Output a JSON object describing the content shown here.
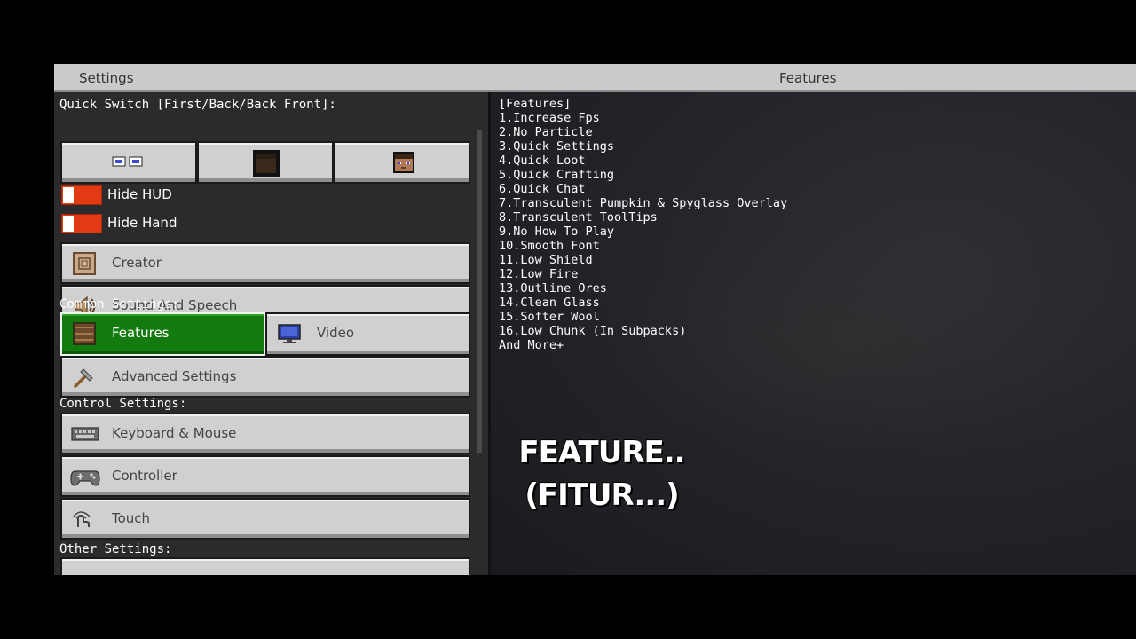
{
  "header": {
    "left_title": "Settings",
    "right_title": "Features"
  },
  "sidebar": {
    "quick_switch_label": "Quick Switch [First/Back/Back Front]:",
    "toggles": [
      {
        "label": "Hide HUD",
        "state": "off"
      },
      {
        "label": "Hide Hand",
        "state": "off"
      }
    ],
    "buttons": {
      "creator": "Creator",
      "sound": "Sound And Speech",
      "features": "Features",
      "video": "Video",
      "advanced": "Advanced Settings",
      "keyboard": "Keyboard & Mouse",
      "controller": "Controller",
      "touch": "Touch"
    },
    "common_label": "Common Settings:",
    "control_label": "Control Settings:",
    "other_label": "Other Settings:"
  },
  "content": {
    "lines": [
      "[Features]",
      "1.Increase Fps",
      "2.No Particle",
      "3.Quick Settings",
      "4.Quick Loot",
      "5.Quick Crafting",
      "6.Quick Chat",
      "7.Transculent Pumpkin & Spyglass Overlay",
      "8.Transculent ToolTips",
      "9.No How To Play",
      "10.Smooth Font",
      "11.Low Shield",
      "12.Low Fire",
      "13.Outline Ores",
      "14.Clean Glass",
      "15.Softer Wool",
      "16.Low Chunk (In Subpacks)",
      "And More+"
    ],
    "overlay_line1": "FEATURE..",
    "overlay_line2": "(FITUR...)"
  },
  "colors": {
    "accent_green": "#137a10",
    "toggle_red": "#e23b14",
    "button_gray": "#d0d0d0"
  },
  "icons": [
    "perspective-icon",
    "player-back-icon",
    "player-front-icon",
    "creator-icon",
    "speaker-icon",
    "bookshelf-icon",
    "monitor-icon",
    "hammer-icon",
    "keyboard-icon",
    "controller-icon",
    "touch-icon"
  ]
}
